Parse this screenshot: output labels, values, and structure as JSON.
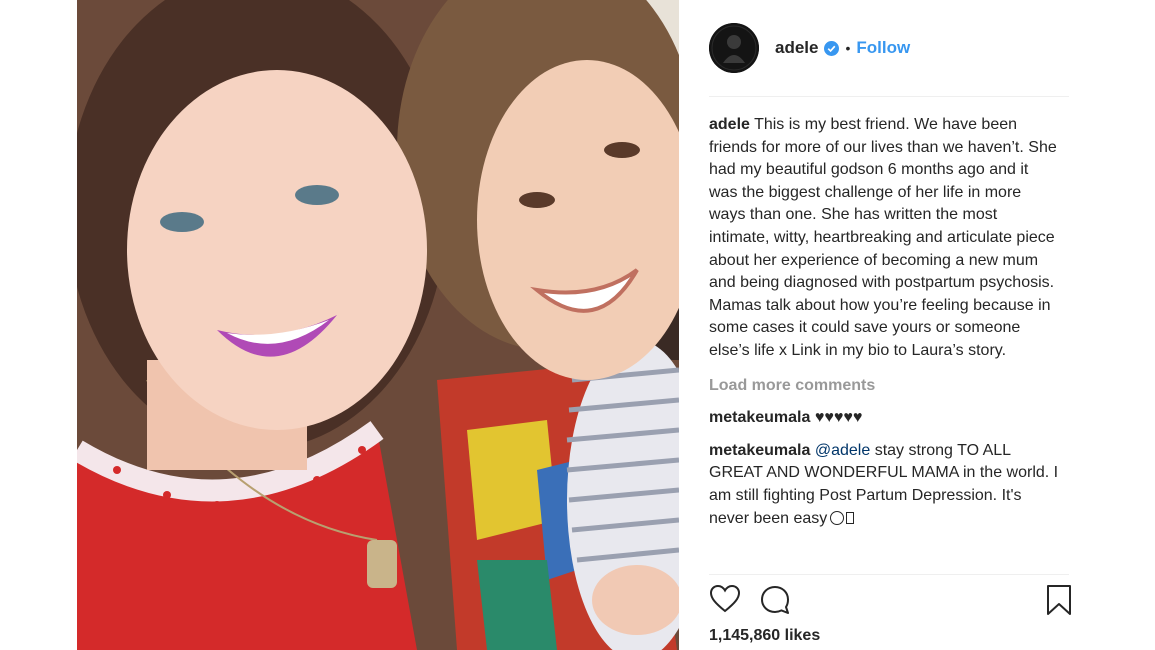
{
  "post": {
    "username": "adele",
    "separator": "•",
    "follow_label": "Follow",
    "verified_icon": "verified-badge-icon",
    "avatar_icon": "profile-avatar"
  },
  "caption": {
    "username": "adele",
    "text": "This is my best friend. We have been friends for more of our lives than we haven’t. She had my beautiful godson 6 months ago and it was the biggest challenge of her life in more ways than one. She has written the most intimate, witty, heartbreaking and articulate piece about her experience of becoming a new mum and being diagnosed with postpartum psychosis. Mamas talk about how you’re feeling because in some cases it could save yours or someone else’s life x Link in my bio to Laura’s story."
  },
  "load_more_label": "Load more comments",
  "comments": [
    {
      "username": "metakeumala",
      "text": "♥♥♥♥♥"
    },
    {
      "username": "metakeumala",
      "mention": "@adele",
      "text": "stay strong TO ALL GREAT AND WONDERFUL MAMA in the world. I am still fighting Post Partum Depression. It's never been easy"
    }
  ],
  "actions": {
    "like_icon": "heart-icon",
    "comment_icon": "comment-icon",
    "save_icon": "bookmark-icon"
  },
  "likes_text": "1,145,860 likes",
  "colors": {
    "link": "#3897f0",
    "text": "#262626",
    "muted": "#999999",
    "mention": "#003569",
    "divider": "#efefef"
  }
}
